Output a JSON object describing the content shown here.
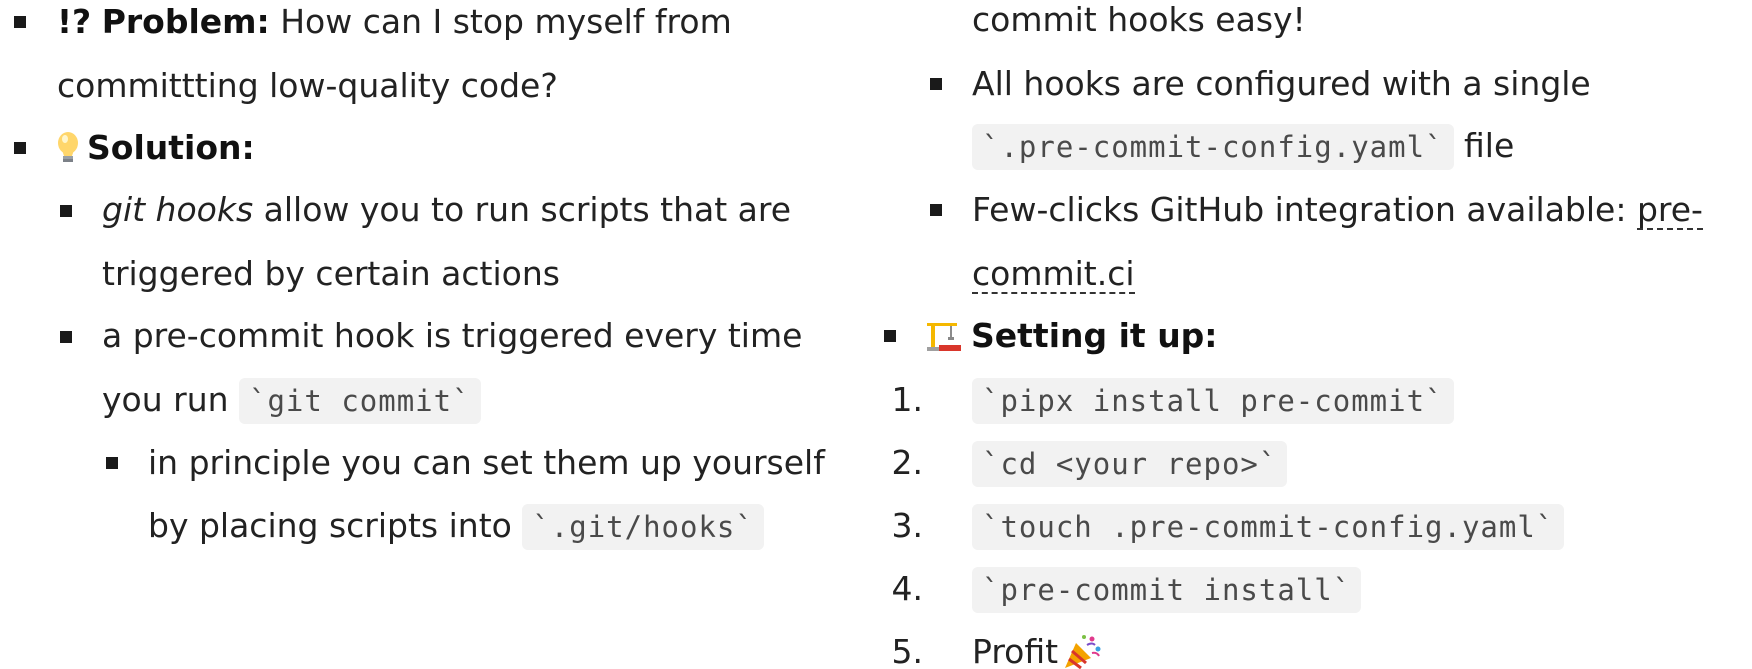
{
  "left": {
    "problem": {
      "marker": "!?",
      "label": "Problem:",
      "text_line1": "How can I stop myself from",
      "text_line2": "committting low-quality code?"
    },
    "solution": {
      "label": "Solution:",
      "icon": "lightbulb-icon"
    },
    "git_hooks_item": {
      "term": "git hooks",
      "text_line1": " allow you to run scripts that are",
      "text_line2": "triggered by certain actions"
    },
    "pre_commit_item": {
      "text_line1": "a pre-commit hook is triggered every time",
      "text_line2_prefix": "you run ",
      "code": "`git commit`"
    },
    "principle_item": {
      "text_line1": "in principle you can set them up yourself",
      "text_line2_prefix": "by placing scripts into ",
      "code": "`.git/hooks`"
    }
  },
  "right": {
    "continuation": "commit hooks easy!",
    "config_item": {
      "text_line1": "All hooks are configured with a single",
      "code": "`.pre-commit-config.yaml`",
      "suffix": " file"
    },
    "github_item": {
      "text": "Few-clicks GitHub integration available: ",
      "link_part1": "pre-",
      "link_part2": "commit.ci"
    },
    "setup": {
      "label": "Setting it up:",
      "icon": "construction-crane-icon"
    },
    "steps": [
      {
        "num": "1.",
        "code": "`pipx install pre-commit`"
      },
      {
        "num": "2.",
        "code": "`cd <your repo>`"
      },
      {
        "num": "3.",
        "code": "`touch .pre-commit-config.yaml`"
      },
      {
        "num": "4.",
        "code": "`pre-commit install`"
      },
      {
        "num": "5.",
        "text": "Profit",
        "icon": "party-popper-icon"
      }
    ]
  }
}
